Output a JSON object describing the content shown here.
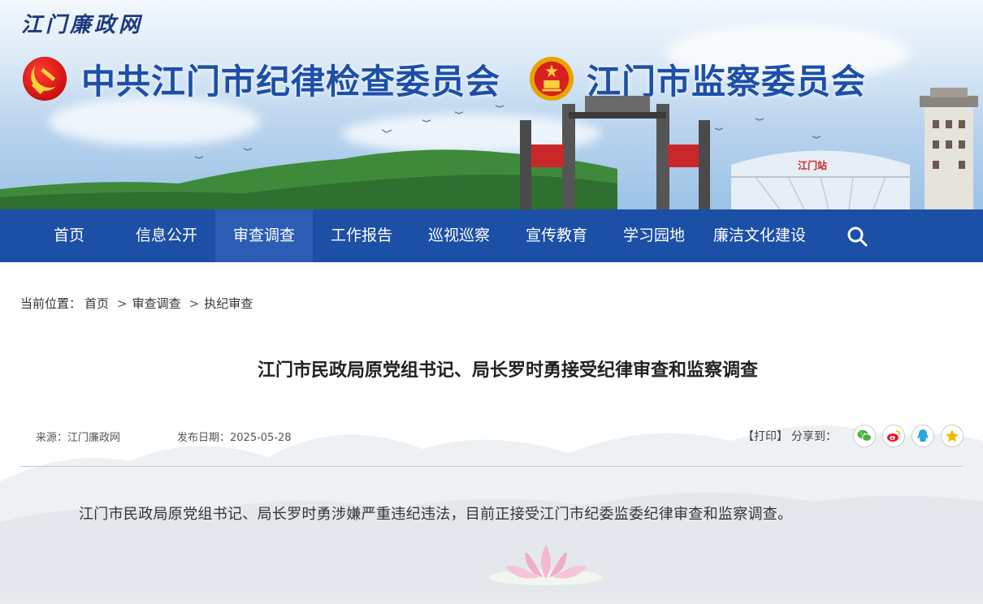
{
  "header": {
    "site_name": "江门廉政网",
    "org_title_1": "中共江门市纪律检查委员会",
    "org_title_2": "江门市监察委员会",
    "gate_sign": "江门站"
  },
  "nav": {
    "items": [
      {
        "label": "首页"
      },
      {
        "label": "信息公开"
      },
      {
        "label": "审查调查"
      },
      {
        "label": "工作报告"
      },
      {
        "label": "巡视巡察"
      },
      {
        "label": "宣传教育"
      },
      {
        "label": "学习园地"
      },
      {
        "label": "廉洁文化建设"
      }
    ],
    "active_index": 2,
    "search_icon": "search-icon"
  },
  "breadcrumb": {
    "prefix": "当前位置：",
    "items": [
      "首页",
      "审查调查",
      "执纪审查"
    ],
    "separator": ">"
  },
  "article": {
    "title": "江门市民政局原党组书记、局长罗时勇接受纪律审查和监察调查",
    "source": "来源：江门廉政网",
    "date": "发布日期：2025-05-28",
    "body": "江门市民政局原党组书记、局长罗时勇涉嫌严重违纪违法，目前正接受江门市纪委监委纪律审查和监察调查。"
  },
  "share": {
    "print_label": "【打印】",
    "share_label": "分享到：",
    "buttons": [
      "wechat-icon",
      "weibo-icon",
      "qq-icon",
      "qzone-icon"
    ]
  },
  "colors": {
    "nav_bg": "#1c4fa6",
    "nav_active": "#2a5db3",
    "title_blue": "#1d4fa8"
  }
}
